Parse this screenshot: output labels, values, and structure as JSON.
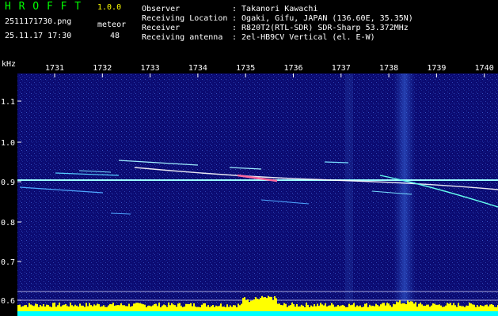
{
  "app": {
    "name": "H R O F F T",
    "version": "1.0.0"
  },
  "file": {
    "name": "2511171730.png",
    "datetime": "25.11.17 17:30"
  },
  "meteor": {
    "label": "meteor",
    "count": "48"
  },
  "info": {
    "observer": {
      "label": "Observer",
      "value": ": Takanori Kawachi"
    },
    "location": {
      "label": "Receiving Location",
      "value": ": Ogaki, Gifu, JAPAN (136.60E, 35.35N)"
    },
    "receiver": {
      "label": "Receiver",
      "value": ": R820T2(RTL-SDR) SDR-Sharp 53.372MHz"
    },
    "antenna": {
      "label": "Receiving antenna",
      "value": ": 2el-HB9CV Vertical (el. E-W)"
    }
  },
  "axis": {
    "y_unit": "kHz",
    "y_ticks": [
      "1.1",
      "1.0",
      "0.9",
      "0.8",
      "0.7",
      "0.6"
    ],
    "x_ticks": [
      "1731",
      "1732",
      "1733",
      "1734",
      "1735",
      "1736",
      "1737",
      "1738",
      "1739",
      "1740"
    ]
  },
  "colors": {
    "header_green": "#00ff00",
    "header_white": "#ffffff",
    "header_yellow": "#ffff00",
    "background": "#0a0a6e",
    "carrier": "#9fffff",
    "meteor_trail": "#ffffff",
    "noise_bar": "#ffff00",
    "noise_base": "#00ffff"
  }
}
